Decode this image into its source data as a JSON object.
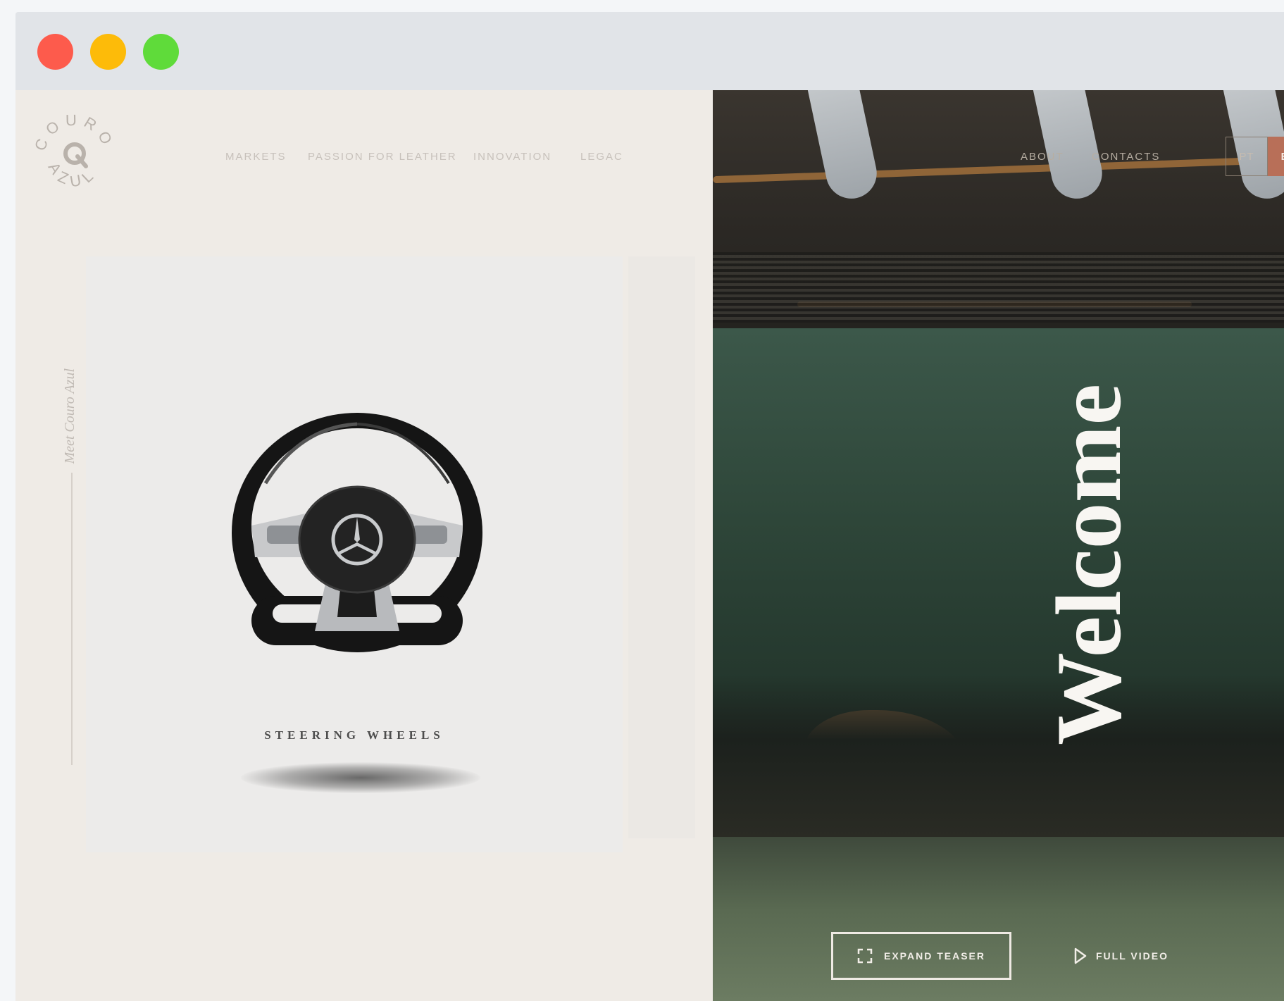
{
  "brand": {
    "logo_top": "COURO",
    "logo_bottom": "AZUL",
    "logo_mark": "Q"
  },
  "nav": {
    "items": [
      {
        "label": "MARKETS"
      },
      {
        "label": "PASSION FOR LEATHER"
      },
      {
        "label": "INNOVATION"
      },
      {
        "label": "LEGAC"
      }
    ],
    "hero_items": [
      {
        "label": "ABOUT"
      },
      {
        "label": "CONTACTS"
      }
    ]
  },
  "language": {
    "pt": "PT",
    "en": "EN",
    "active": "EN"
  },
  "side": {
    "label": "Meet Couro Azul"
  },
  "card": {
    "caption": "STEERING WHEELS",
    "image": "steering-wheel"
  },
  "hero": {
    "title": "Welcome",
    "expand_label": "EXPAND TEASER",
    "video_label": "FULL VIDEO"
  },
  "colors": {
    "accent_lang": "#b86f58",
    "traffic_red": "#fd5b4c",
    "traffic_yellow": "#fdbb09",
    "traffic_green": "#5fdb3a",
    "panel_bg": "#efebe6"
  }
}
